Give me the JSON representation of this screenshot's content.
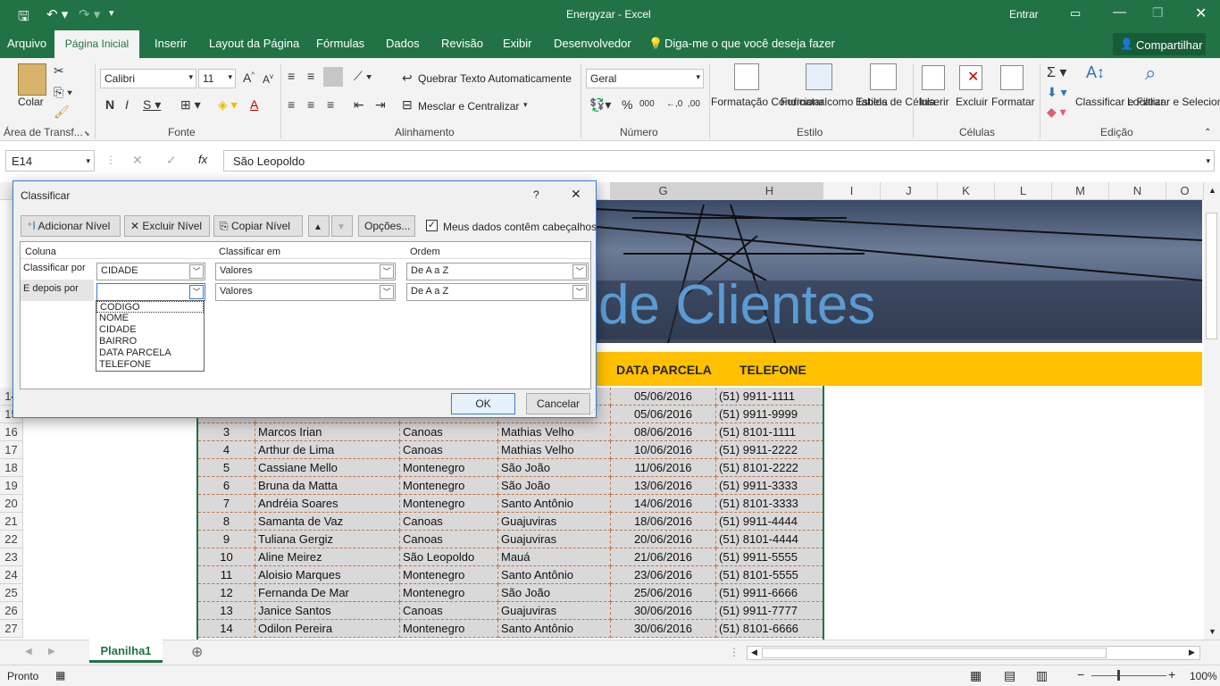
{
  "app": {
    "title": "Energyzar  -  Excel",
    "signin": "Entrar"
  },
  "tabs": [
    "Arquivo",
    "Página Inicial",
    "Inserir",
    "Layout da Página",
    "Fórmulas",
    "Dados",
    "Revisão",
    "Exibir",
    "Desenvolvedor"
  ],
  "tellme": "Diga-me o que você deseja fazer",
  "share": "Compartilhar",
  "ribbon": {
    "paste": "Colar",
    "clipboard": "Área de Transf...",
    "font_name": "Calibri",
    "font_size": "11",
    "font_group": "Fonte",
    "wrap_text": "Quebrar Texto Automaticamente",
    "merge": "Mesclar e Centralizar",
    "alignment_group": "Alinhamento",
    "number_format": "Geral",
    "number_group": "Número",
    "cond_format": "Formatação Condicional",
    "format_table": "Formatar como Tabela",
    "cell_styles": "Estilos de Célula",
    "styles_group": "Estilo",
    "insert": "Inserir",
    "delete": "Excluir",
    "format": "Formatar",
    "cells_group": "Células",
    "sort_filter": "Classificar e Filtrar",
    "find_select": "Localizar e Selecionar",
    "editing_group": "Edição"
  },
  "formula_bar": {
    "name_box": "E14",
    "formula": "São Leopoldo"
  },
  "columns": [
    "G",
    "H",
    "I",
    "J",
    "K",
    "L",
    "M",
    "N",
    "O"
  ],
  "banner_text": "de Clientes",
  "headers": {
    "data_parcela": "DATA PARCELA",
    "telefone": "TELEFONE"
  },
  "rows": [
    {
      "num": "14",
      "code": "",
      "name": "",
      "city": "",
      "district": "",
      "date": "05/06/2016",
      "phone": "(51) 9911-1111"
    },
    {
      "num": "15",
      "code": "",
      "name": "",
      "city": "",
      "district": "",
      "date": "05/06/2016",
      "phone": "(51) 9911-9999"
    },
    {
      "num": "16",
      "code": "3",
      "name": "Marcos Irian",
      "city": "Canoas",
      "district": "Mathias Velho",
      "date": "08/06/2016",
      "phone": "(51) 8101-1111"
    },
    {
      "num": "17",
      "code": "4",
      "name": "Arthur de Lima",
      "city": "Canoas",
      "district": "Mathias Velho",
      "date": "10/06/2016",
      "phone": "(51) 9911-2222"
    },
    {
      "num": "18",
      "code": "5",
      "name": "Cassiane Mello",
      "city": "Montenegro",
      "district": "São João",
      "date": "11/06/2016",
      "phone": "(51) 8101-2222"
    },
    {
      "num": "19",
      "code": "6",
      "name": "Bruna da Matta",
      "city": "Montenegro",
      "district": "São João",
      "date": "13/06/2016",
      "phone": "(51) 9911-3333"
    },
    {
      "num": "20",
      "code": "7",
      "name": "Andréia Soares",
      "city": "Montenegro",
      "district": "Santo Antônio",
      "date": "14/06/2016",
      "phone": "(51) 8101-3333"
    },
    {
      "num": "21",
      "code": "8",
      "name": "Samanta de Vaz",
      "city": "Canoas",
      "district": "Guajuviras",
      "date": "18/06/2016",
      "phone": "(51) 9911-4444"
    },
    {
      "num": "22",
      "code": "9",
      "name": "Tuliana Gergiz",
      "city": "Canoas",
      "district": "Guajuviras",
      "date": "20/06/2016",
      "phone": "(51) 8101-4444"
    },
    {
      "num": "23",
      "code": "10",
      "name": "Aline Meirez",
      "city": "São Leopoldo",
      "district": "Mauá",
      "date": "21/06/2016",
      "phone": "(51) 9911-5555"
    },
    {
      "num": "24",
      "code": "11",
      "name": "Aloisio Marques",
      "city": "Montenegro",
      "district": "Santo Antônio",
      "date": "23/06/2016",
      "phone": "(51) 8101-5555"
    },
    {
      "num": "25",
      "code": "12",
      "name": "Fernanda De Mar",
      "city": "Montenegro",
      "district": "São João",
      "date": "25/06/2016",
      "phone": "(51) 9911-6666"
    },
    {
      "num": "26",
      "code": "13",
      "name": "Janice Santos",
      "city": "Canoas",
      "district": "Guajuviras",
      "date": "30/06/2016",
      "phone": "(51) 9911-7777"
    },
    {
      "num": "27",
      "code": "14",
      "name": "Odilon Pereira",
      "city": "Montenegro",
      "district": "Santo Antônio",
      "date": "30/06/2016",
      "phone": "(51) 8101-6666"
    }
  ],
  "sheet_tab": "Planilha1",
  "status": {
    "ready": "Pronto",
    "zoom": "100%"
  },
  "dialog": {
    "title": "Classificar",
    "help": "?",
    "add_level": "Adicionar Nível",
    "delete_level": "Excluir Nível",
    "copy_level": "Copiar Nível",
    "options": "Opções...",
    "has_headers": "Meus dados contêm cabeçalhos",
    "col_header": "Coluna",
    "sort_on_header": "Classificar em",
    "order_header": "Ordem",
    "sort_by": "Classificar por",
    "then_by": "E depois por",
    "level1": {
      "column": "CIDADE",
      "sort_on": "Valores",
      "order": "De A a Z"
    },
    "level2": {
      "column": "",
      "sort_on": "Valores",
      "order": "De A a Z"
    },
    "dropdown_options": [
      "CODIGO",
      "NOME",
      "CIDADE",
      "BAIRRO",
      "DATA PARCELA",
      "TELEFONE"
    ],
    "ok": "OK",
    "cancel": "Cancelar"
  },
  "colors": {
    "excel_green": "#217346",
    "header_yellow": "#FFC000",
    "banner_text": "#5b9bd5"
  }
}
